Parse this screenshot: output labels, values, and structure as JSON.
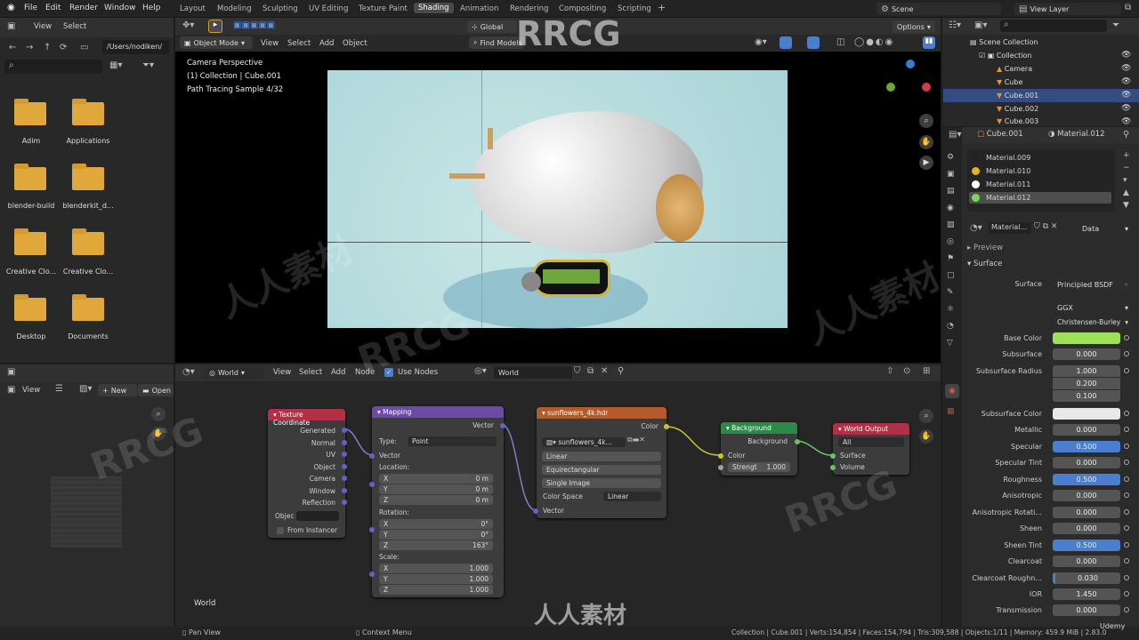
{
  "menu": [
    "File",
    "Edit",
    "Render",
    "Window",
    "Help"
  ],
  "workspaces": [
    "Layout",
    "Modeling",
    "Sculpting",
    "UV Editing",
    "Texture Paint",
    "Shading",
    "Animation",
    "Rendering",
    "Compositing",
    "Scripting"
  ],
  "active_workspace": "Shading",
  "scene": "Scene",
  "view_layer": "View Layer",
  "filebrowser": {
    "header": [
      "View",
      "Select"
    ],
    "path": "/Users/nodiken/",
    "items": [
      "Adim",
      "Applications",
      "blender-build",
      "blenderkit_d...",
      "Creative Clo...",
      "Creative Clo...",
      "Desktop",
      "Documents"
    ]
  },
  "viewport": {
    "mode": "Object Mode",
    "menus": [
      "View",
      "Select",
      "Add",
      "Object"
    ],
    "orientation": "Global",
    "find": "Find Models",
    "options": "Options",
    "info": [
      "Camera Perspective",
      "(1) Collection | Cube.001",
      "Path Tracing Sample 4/32"
    ]
  },
  "imgeditor": {
    "view": "View",
    "new": "New",
    "open": "Open"
  },
  "nodeeditor": {
    "type": "World",
    "menus": [
      "View",
      "Select",
      "Add",
      "Node"
    ],
    "use_nodes": "Use Nodes",
    "world_name": "World",
    "footer_label": "World"
  },
  "nodes": {
    "texcoord": {
      "title": "Texture Coordinate",
      "outputs": [
        "Generated",
        "Normal",
        "UV",
        "Object",
        "Camera",
        "Window",
        "Reflection"
      ],
      "object_label": "Objec",
      "from_instancer": "From Instancer"
    },
    "mapping": {
      "title": "Mapping",
      "output": "Vector",
      "type_label": "Type:",
      "type_value": "Point",
      "vector": "Vector",
      "location": "Location:",
      "loc": [
        "0 m",
        "0 m",
        "0 m"
      ],
      "rotation": "Rotation:",
      "rot": [
        "0°",
        "0°",
        "163°"
      ],
      "scale": "Scale:",
      "scl": [
        "1.000",
        "1.000",
        "1.000"
      ],
      "axes": [
        "X",
        "Y",
        "Z"
      ]
    },
    "env": {
      "title": "sunflowers_4k.hdr",
      "output": "Color",
      "image": "sunflowers_4k...",
      "opts": [
        "Linear",
        "Equirectangular",
        "Single Image"
      ],
      "colorspace_label": "Color Space",
      "colorspace": "Linear",
      "input": "Vector"
    },
    "background": {
      "title": "Background",
      "output": "Background",
      "color": "Color",
      "strength": "Strengt",
      "strength_value": "1.000"
    },
    "worldout": {
      "title": "World Output",
      "target": "All",
      "surface": "Surface",
      "volume": "Volume"
    }
  },
  "outliner": {
    "root": "Scene Collection",
    "rows": [
      "Collection",
      "Camera",
      "Cube",
      "Cube.001",
      "Cube.002",
      "Cube.003"
    ]
  },
  "properties": {
    "object": "Cube.001",
    "material": "Material.012",
    "slots": [
      "Material.009",
      "Material.010",
      "Material.011",
      "Material.012"
    ],
    "slot_colors": [
      "#222222",
      "#e8b020",
      "#ffffff",
      "#7cd65a"
    ],
    "mat_field": "Material...",
    "data": "Data",
    "preview": "Preview",
    "surface_header": "Surface",
    "surface_label": "Surface",
    "surface_value": "Principled BSDF",
    "dist": "GGX",
    "sss_method": "Christensen-Burley",
    "rows": [
      {
        "label": "Base Color",
        "value": ""
      },
      {
        "label": "Subsurface",
        "value": "0.000"
      },
      {
        "label": "Subsurface Radius",
        "value": "1.000"
      },
      {
        "label": "",
        "value": "0.200"
      },
      {
        "label": "",
        "value": "0.100"
      },
      {
        "label": "Subsurface Color",
        "value": ""
      },
      {
        "label": "Metallic",
        "value": "0.000"
      },
      {
        "label": "Specular",
        "value": "0.500"
      },
      {
        "label": "Specular Tint",
        "value": "0.000"
      },
      {
        "label": "Roughness",
        "value": "0.500"
      },
      {
        "label": "Anisotropic",
        "value": "0.000"
      },
      {
        "label": "Anisotropic Rotati...",
        "value": "0.000"
      },
      {
        "label": "Sheen",
        "value": "0.000"
      },
      {
        "label": "Sheen Tint",
        "value": "0.500"
      },
      {
        "label": "Clearcoat",
        "value": "0.000"
      },
      {
        "label": "Clearcoat Roughn...",
        "value": "0.030"
      },
      {
        "label": "IOR",
        "value": "1.450"
      },
      {
        "label": "Transmission",
        "value": "0.000"
      }
    ],
    "base_color": "#9ee05a",
    "subsurface_color": "#e8e8e8",
    "accent": "#4a7fd0"
  },
  "statusbar": {
    "left": "Pan View",
    "mid": "Context Menu",
    "right": "Collection | Cube.001 | Verts:154,854 | Faces:154,794 | Tris:309,588 | Objects:1/11 | Memory: 459.9 MiB | 2.83.0"
  },
  "watermarks": {
    "rrcg": "RRCG",
    "cn": "人人素材",
    "udemy": "Udemy"
  }
}
